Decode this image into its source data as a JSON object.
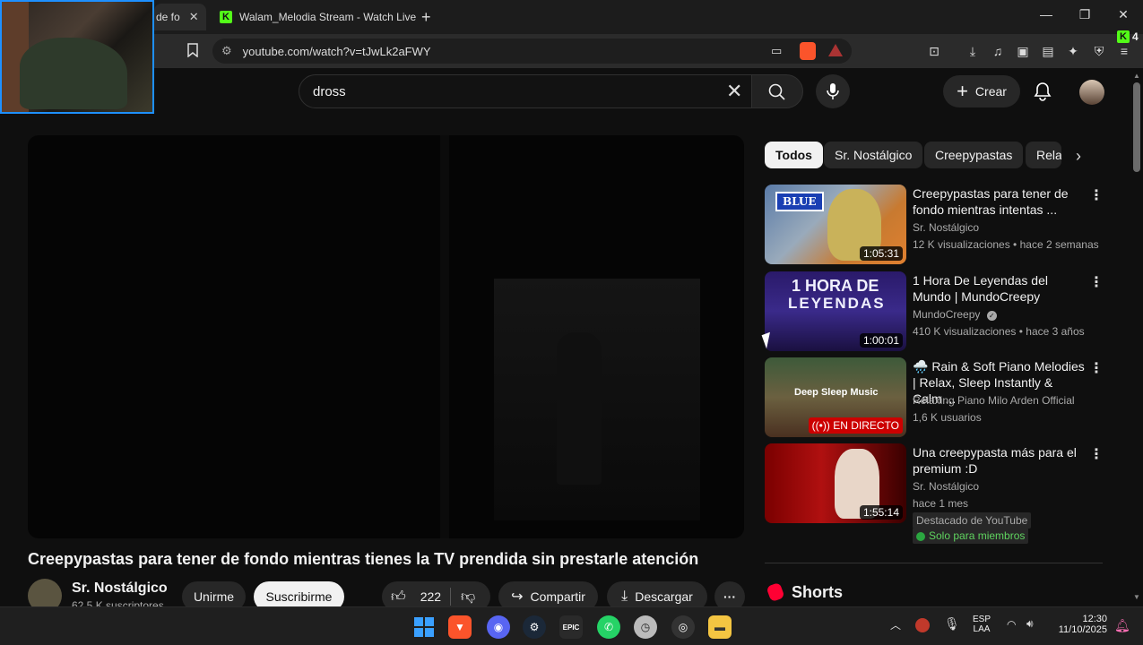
{
  "browser": {
    "tabs": [
      {
        "label": "de fo"
      },
      {
        "label": "Walam_Melodia Stream - Watch Live"
      }
    ],
    "url": "youtube.com/watch?v=tJwLk2aFWY",
    "ext_badge": "4"
  },
  "yt": {
    "search_value": "dross",
    "create_label": "Crear"
  },
  "video": {
    "title": "Creepypastas para tener de fondo mientras tienes la TV prendida sin prestarle atención",
    "channel": "Sr. Nostálgico",
    "subs": "62,5 K suscriptores",
    "join_label": "Unirme",
    "subscribe_label": "Suscribirme",
    "likes": "222",
    "share_label": "Compartir",
    "download_label": "Descargar"
  },
  "chips": [
    "Todos",
    "Sr. Nostálgico",
    "Creepypastas",
    "Rela"
  ],
  "recs": [
    {
      "title": "Creepypastas para tener de fondo mientras intentas ...",
      "channel": "Sr. Nostálgico",
      "meta": "12 K visualizaciones • hace 2 semanas",
      "duration": "1:05:31",
      "thumb_text": "BLUE"
    },
    {
      "title": "1 Hora De Leyendas del Mundo | MundoCreepy",
      "channel": "MundoCreepy",
      "meta": "410 K visualizaciones • hace 3 años",
      "duration": "1:00:01",
      "thumb_text_1": "1 HORA DE",
      "thumb_text_2": "LEYENDAS"
    },
    {
      "title": "🌧️ Rain & Soft Piano Melodies | Relax, Sleep Instantly & Calm ...",
      "channel": "Relaxing Piano Milo Arden Official",
      "meta": "1,6 K usuarios",
      "live_label": "EN DIRECTO",
      "thumb_text": "Deep Sleep Music"
    },
    {
      "title": "Una creepypasta más para el premium :D",
      "channel": "Sr. Nostálgico",
      "meta": "hace 1 mes",
      "duration": "1:55:14",
      "badge1": "Destacado de YouTube",
      "badge2": "Solo para miembros"
    }
  ],
  "shorts_label": "Shorts",
  "taskbar": {
    "lang1": "ESP",
    "lang2": "LAA",
    "time": "12:30",
    "date": "11/10/2025"
  }
}
